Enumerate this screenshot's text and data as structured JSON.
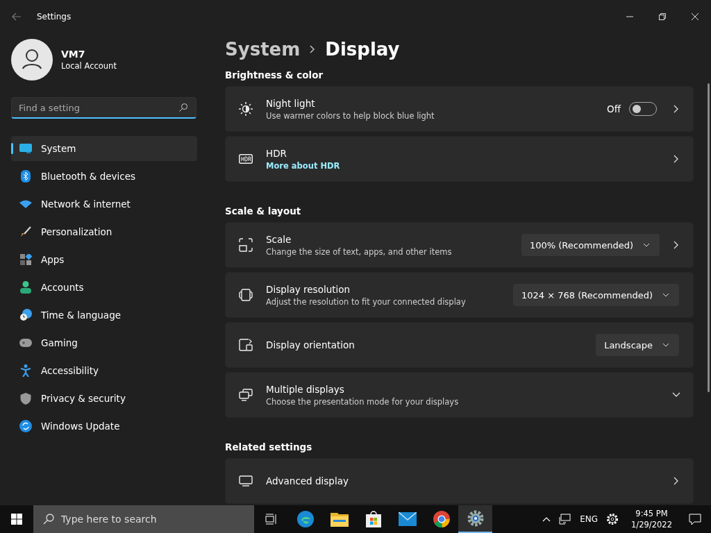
{
  "window": {
    "title": "Settings"
  },
  "user": {
    "name": "VM7",
    "account": "Local Account"
  },
  "search": {
    "placeholder": "Find a setting"
  },
  "nav": [
    {
      "label": "System",
      "selected": true
    },
    {
      "label": "Bluetooth & devices",
      "selected": false
    },
    {
      "label": "Network & internet",
      "selected": false
    },
    {
      "label": "Personalization",
      "selected": false
    },
    {
      "label": "Apps",
      "selected": false
    },
    {
      "label": "Accounts",
      "selected": false
    },
    {
      "label": "Time & language",
      "selected": false
    },
    {
      "label": "Gaming",
      "selected": false
    },
    {
      "label": "Accessibility",
      "selected": false
    },
    {
      "label": "Privacy & security",
      "selected": false
    },
    {
      "label": "Windows Update",
      "selected": false
    }
  ],
  "breadcrumb": {
    "parent": "System",
    "current": "Display"
  },
  "sections": [
    {
      "heading": "Brightness & color",
      "cards": [
        {
          "kind": "toggle",
          "title": "Night light",
          "subtitle": "Use warmer colors to help block blue light",
          "state_label": "Off",
          "on": false
        },
        {
          "kind": "link",
          "title": "HDR",
          "link": "More about HDR"
        }
      ]
    },
    {
      "heading": "Scale & layout",
      "cards": [
        {
          "kind": "dropdown",
          "title": "Scale",
          "subtitle": "Change the size of text, apps, and other items",
          "value": "100% (Recommended)",
          "chevron": true
        },
        {
          "kind": "dropdown",
          "title": "Display resolution",
          "subtitle": "Adjust the resolution to fit your connected display",
          "value": "1024 × 768 (Recommended)",
          "chevron": false
        },
        {
          "kind": "dropdown",
          "title": "Display orientation",
          "value": "Landscape",
          "chevron": false
        },
        {
          "kind": "expand",
          "title": "Multiple displays",
          "subtitle": "Choose the presentation mode for your displays",
          "expanded": false
        }
      ]
    },
    {
      "heading": "Related settings",
      "cards": [
        {
          "kind": "nav",
          "title": "Advanced display"
        }
      ]
    }
  ],
  "taskbar": {
    "search_placeholder": "Type here to search",
    "apps": [
      {
        "selected": false
      },
      {
        "selected": false
      },
      {
        "selected": false
      },
      {
        "selected": false
      },
      {
        "selected": false
      },
      {
        "selected": false
      },
      {
        "selected": true
      }
    ],
    "language": "ENG",
    "time": "9:45 PM",
    "date": "1/29/2022"
  }
}
